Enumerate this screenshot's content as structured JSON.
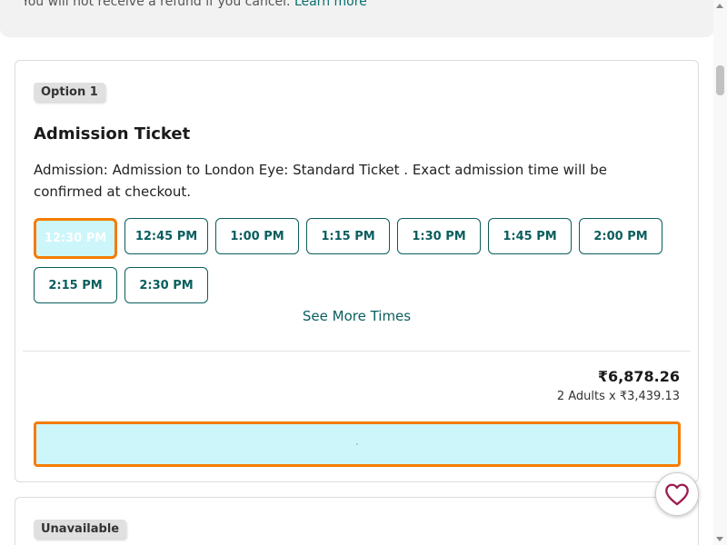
{
  "notice": {
    "text": "You will not receive a refund if you cancel.",
    "link": "Learn more"
  },
  "option": {
    "badge": "Option 1",
    "title": "Admission Ticket",
    "description": "Admission: Admission to London Eye: Standard Ticket . Exact admission time will be confirmed at checkout.",
    "times": [
      {
        "label": "12:30 PM",
        "selected": true
      },
      {
        "label": "12:45 PM",
        "selected": false
      },
      {
        "label": "1:00 PM",
        "selected": false
      },
      {
        "label": "1:15 PM",
        "selected": false
      },
      {
        "label": "1:30 PM",
        "selected": false
      },
      {
        "label": "1:45 PM",
        "selected": false
      },
      {
        "label": "2:00 PM",
        "selected": false
      },
      {
        "label": "2:15 PM",
        "selected": false
      },
      {
        "label": "2:30 PM",
        "selected": false
      }
    ],
    "see_more": "See More Times",
    "price": "₹6,878.26",
    "price_breakdown": "2 Adults x ₹3,439.13",
    "book_label": ""
  },
  "option2": {
    "badge": "Unavailable"
  },
  "colors": {
    "accent": "#0b5e5e",
    "selected_border": "#f57c00",
    "selected_fill": "#ccf6fa",
    "heart": "#9c1d52"
  },
  "icons": {
    "favorite": "heart-icon"
  }
}
